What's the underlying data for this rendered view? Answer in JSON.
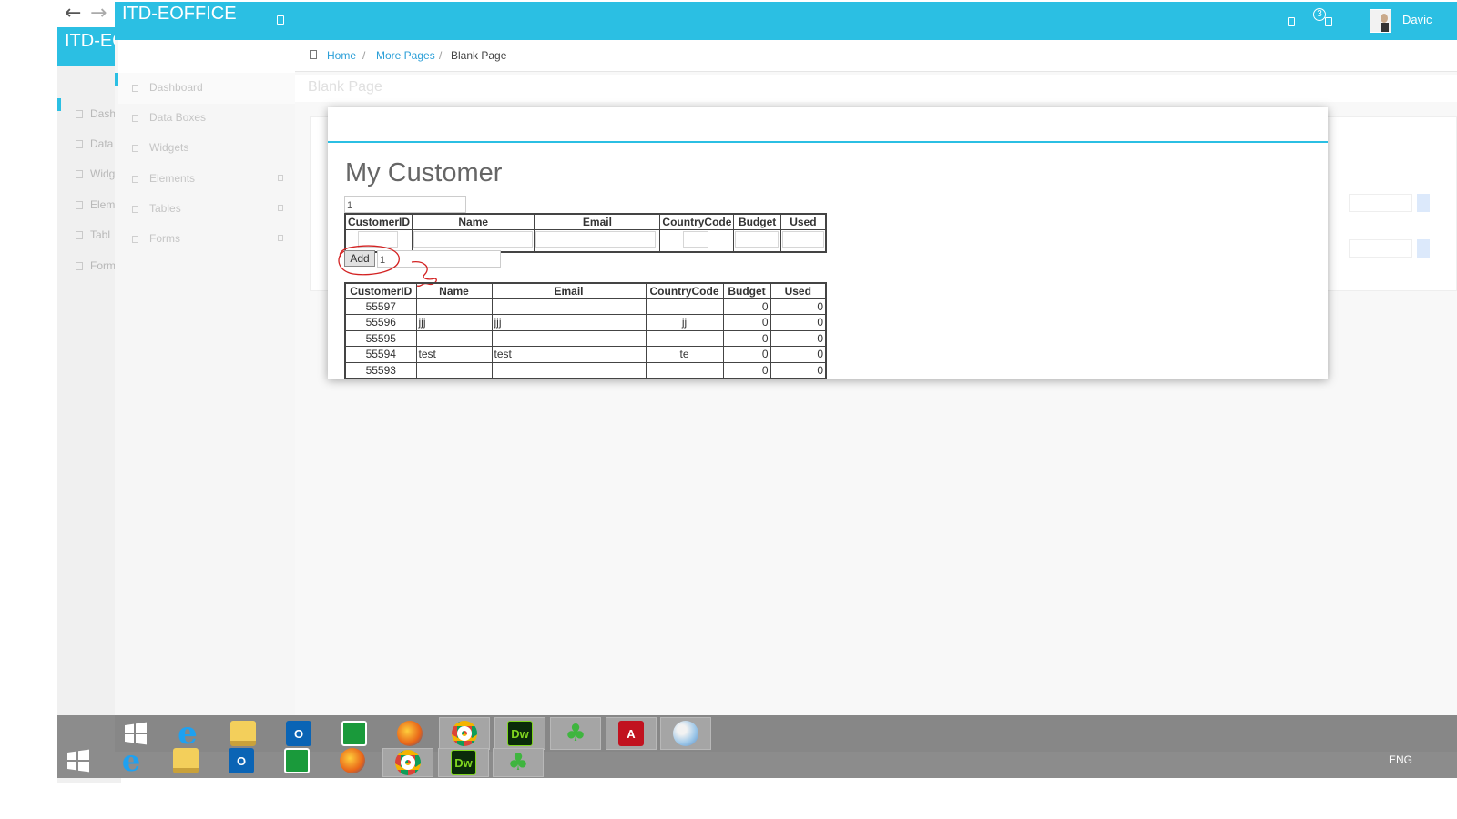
{
  "browser": {
    "back_icon": "←",
    "forward_icon": "→"
  },
  "back_window": {
    "title": "ITD-EO",
    "sidebar": [
      "Dash",
      "Data",
      "Widg",
      "Elem",
      "Tabl",
      "Form"
    ]
  },
  "header": {
    "app_title": "ITD-EOFFICE",
    "notification_count": "3",
    "user_name": "Davic"
  },
  "sidebar": {
    "items": [
      "Dashboard",
      "Data Boxes",
      "Widgets",
      "Elements",
      "Tables",
      "Forms"
    ]
  },
  "breadcrumb": {
    "home": "Home",
    "separator": "/",
    "more_pages": "More Pages",
    "current": "Blank Page"
  },
  "page_title": "Blank Page",
  "modal": {
    "title": "My Customer",
    "top_input_value": "1",
    "form_table": {
      "headers": [
        "CustomerID",
        "Name",
        "Email",
        "CountryCode",
        "Budget",
        "Used"
      ]
    },
    "add_label": "Add",
    "add_input_value": "1",
    "data_table": {
      "headers": [
        "CustomerID",
        "Name",
        "Email",
        "CountryCode",
        "Budget",
        "Used"
      ],
      "rows": [
        [
          "55597",
          "",
          "",
          "",
          "0",
          "0"
        ],
        [
          "55596",
          "jjj",
          "jjj",
          "jj",
          "0",
          "0"
        ],
        [
          "55595",
          "",
          "",
          "",
          "0",
          "0"
        ],
        [
          "55594",
          "test",
          "test",
          "te",
          "0",
          "0"
        ],
        [
          "55593",
          "",
          "",
          "",
          "0",
          "0"
        ]
      ]
    }
  },
  "taskbar": {
    "language": "ENG",
    "apps": [
      "start-icon",
      "internet-explorer-icon",
      "file-explorer-icon",
      "outlook-icon",
      "store-icon",
      "firefox-icon",
      "chrome-icon",
      "dreamweaver-icon",
      "clover-icon",
      "acrobat-icon",
      "paint-icon"
    ],
    "outlook_glyph": "O",
    "dreamweaver_glyph": "Dw",
    "ie_glyph": "e",
    "acrobat_glyph": "A"
  },
  "colors": {
    "accent": "#2bbfe3",
    "link": "#2b9fd8",
    "annotation": "#d32222"
  }
}
